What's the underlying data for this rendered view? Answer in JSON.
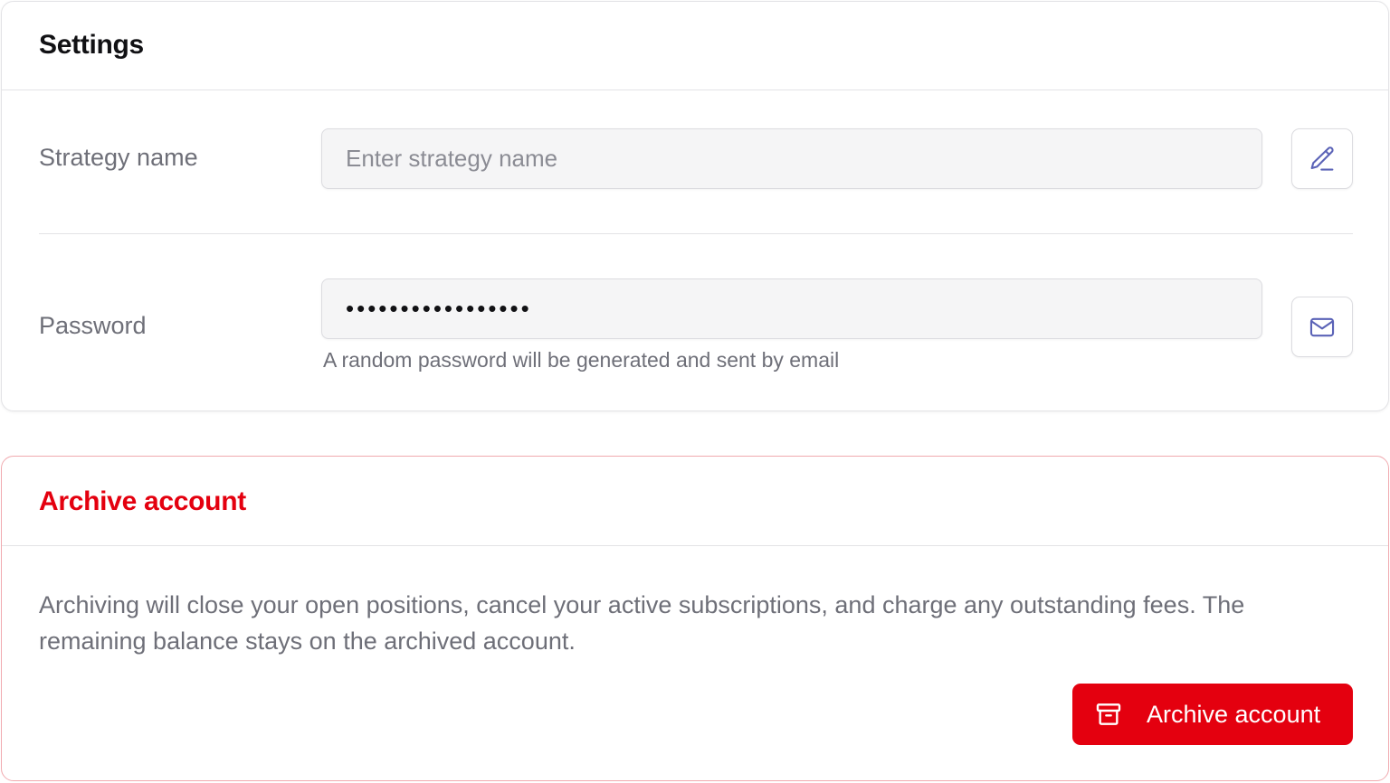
{
  "settings": {
    "title": "Settings",
    "strategy_name": {
      "label": "Strategy name",
      "value": "",
      "placeholder": "Enter strategy name",
      "action_icon": "pencil-icon"
    },
    "password": {
      "label": "Password",
      "value": "•••••••••••••••••",
      "hint": "A random password will be generated and sent by email",
      "action_icon": "mail-icon"
    }
  },
  "archive": {
    "title": "Archive account",
    "description": "Archiving will close your open positions, cancel your active subscriptions, and charge any outstanding fees. The remaining balance stays on the archived account.",
    "button_label": "Archive account",
    "button_icon": "archive-box-icon"
  },
  "colors": {
    "danger": "#e4000f",
    "icon_accent": "#5b63b7",
    "muted_text": "#6e6f78"
  }
}
